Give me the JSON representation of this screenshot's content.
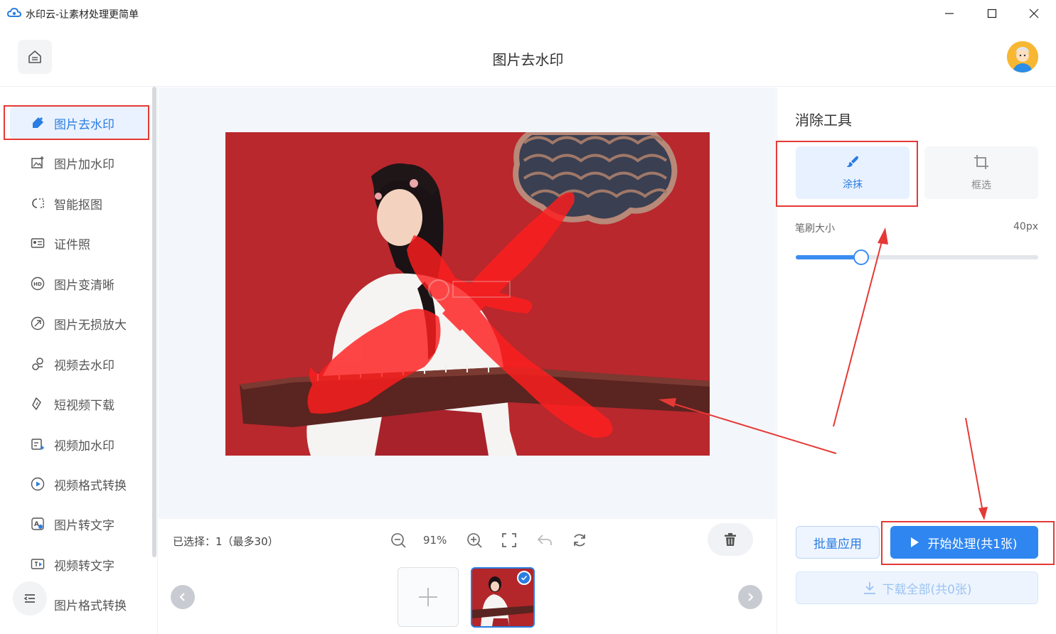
{
  "window": {
    "title": "水印云-让素材处理更简单",
    "min_glyph": "—",
    "max_glyph": "☐",
    "close_glyph": "✕"
  },
  "header": {
    "title": "图片去水印"
  },
  "sidebar": {
    "items": [
      {
        "label": "图片去水印",
        "icon": "eraser-icon",
        "active": true
      },
      {
        "label": "图片加水印",
        "icon": "image-add-icon"
      },
      {
        "label": "智能抠图",
        "icon": "cutout-icon"
      },
      {
        "label": "证件照",
        "icon": "id-card-icon"
      },
      {
        "label": "图片变清晰",
        "icon": "hd-icon"
      },
      {
        "label": "图片无损放大",
        "icon": "enlarge-icon"
      },
      {
        "label": "视频去水印",
        "icon": "video-eraser-icon"
      },
      {
        "label": "短视频下载",
        "icon": "download-link-icon"
      },
      {
        "label": "视频加水印",
        "icon": "video-add-icon"
      },
      {
        "label": "视频格式转换",
        "icon": "play-circle-icon"
      },
      {
        "label": "图片转文字",
        "icon": "image-text-icon"
      },
      {
        "label": "视频转文字",
        "icon": "video-text-icon"
      },
      {
        "label": "图片格式转换",
        "icon": "format-icon"
      }
    ]
  },
  "bottom": {
    "selected_info": "已选择：1（最多30）",
    "zoom": "91%"
  },
  "panel": {
    "title": "消除工具",
    "tools": [
      {
        "label": "涂抹",
        "icon": "brush-icon",
        "active": true
      },
      {
        "label": "框选",
        "icon": "crop-icon",
        "active": false
      }
    ],
    "brush_label": "笔刷大小",
    "brush_value": "40px",
    "brush_level": 0.27,
    "batch_label": "批量应用",
    "start_label": "开始处理(共1张)",
    "download_label": "下载全部(共0张)"
  },
  "colors": {
    "accent": "#2f86f0",
    "annotation_red": "#e53935",
    "paint_red": "#ff1e1e",
    "photo_bg": "#b3262a"
  }
}
